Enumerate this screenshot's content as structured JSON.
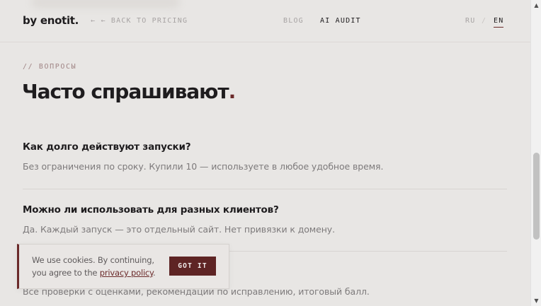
{
  "nav": {
    "logo": "by enotit.",
    "back_link": "← ← BACK TO PRICING",
    "links": [
      {
        "label": "BLOG",
        "active": false
      },
      {
        "label": "AI AUDIT",
        "active": true
      }
    ],
    "lang": {
      "ru": "RU",
      "separator": "/",
      "en": "EN",
      "selected": "EN"
    }
  },
  "section": {
    "eyebrow": "// ВОПРОСЫ",
    "title": "Часто спрашивают",
    "title_dot": "."
  },
  "faq": [
    {
      "question": "Как долго действуют запуски?",
      "answer": "Без ограничения по сроку. Купили 10 — используете в любое удобное время."
    },
    {
      "question": "Можно ли использовать для разных клиентов?",
      "answer": "Да. Каждый запуск — это отдельный сайт. Нет привязки к домену."
    },
    {
      "question": "",
      "answer": "Все проверки с оценками, рекомендации по исправлению, итоговый балл."
    }
  ],
  "cookie": {
    "text_before": "We use cookies. By continuing, you agree to the ",
    "link": "privacy policy",
    "text_after": ".",
    "button": "GOT IT"
  },
  "colors": {
    "background": "#e8e6e4",
    "text": "#1e1c1e",
    "muted": "#a7a3a3",
    "accent": "#6b2a2a"
  },
  "icons": {
    "scroll_up": "triangle-up-icon",
    "scroll_down": "triangle-down-icon"
  }
}
